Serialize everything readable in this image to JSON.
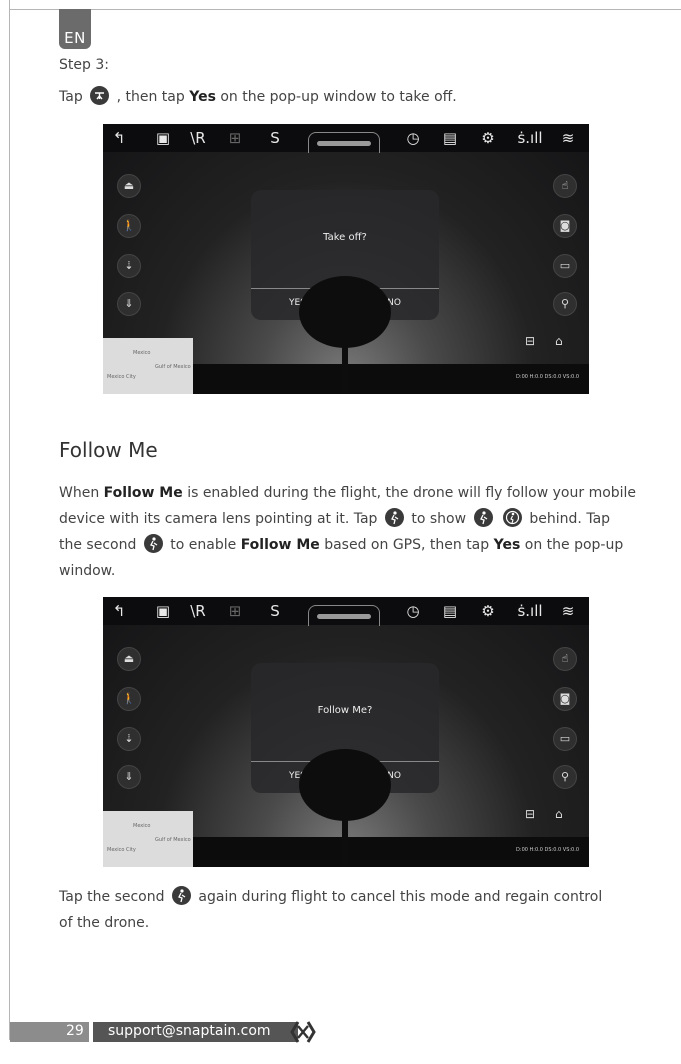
{
  "header": {
    "lang_tab": "EN",
    "step_title": "Step 3:"
  },
  "step3": {
    "t1": "Tap",
    "t2": ", then tap",
    "yes": "Yes",
    "t3": "on the pop-up window to take off."
  },
  "screen1": {
    "question": "Take off?",
    "yes": "YES",
    "no": "NO",
    "telemetry": "D:00 H:0.0 DS:0.0 VS:0.0"
  },
  "section": {
    "title": "Follow Me"
  },
  "follow_para": {
    "l1a": "When",
    "fm": "Follow Me",
    "l1b": "is enabled during the flight, the drone will fly follow your mobile",
    "l2a": "device with its camera lens pointing at it. Tap",
    "l2b": "to show",
    "l2c": "behind. Tap",
    "l3a": "the second",
    "l3b": "to enable",
    "l3c": "based on GPS, then tap",
    "l3d": "on the pop-up",
    "l4": "window."
  },
  "screen2": {
    "question": "Follow Me?",
    "yes": "YES",
    "no": "NO",
    "telemetry": "D:00 H:0.0 DS:0.0 VS:0.0"
  },
  "cancel_para": {
    "l1a": "Tap the second",
    "l1b": "again during flight to cancel this mode and regain control",
    "l2": "of the drone."
  },
  "map_labels": {
    "a": "Mexico",
    "b": "Mexico City",
    "c": "Gulf of Mexico"
  },
  "footer": {
    "page": "29",
    "email": "support@snaptain.com"
  }
}
